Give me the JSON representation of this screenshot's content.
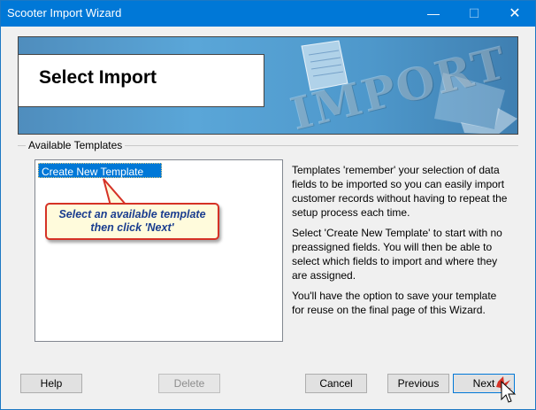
{
  "window": {
    "title": "Scooter Import Wizard",
    "min_glyph": "—",
    "max_glyph": "☐",
    "close_glyph": "✕"
  },
  "banner": {
    "heading": "Select Import",
    "art_word": "IMPORT"
  },
  "group": {
    "label": "Available Templates"
  },
  "templates": {
    "items": [
      "Create New Template"
    ],
    "selected": 0
  },
  "callout": {
    "line1": "Select an available template",
    "line2": "then click 'Next'"
  },
  "description": {
    "p1": "Templates 'remember' your selection of data fields to be imported so you can easily import customer records without having to repeat the setup process each time.",
    "p2": "Select 'Create New Template' to start with no preassigned fields. You will then be able to select which fields to import and where they are assigned.",
    "p3": "You'll have the option to save your template for reuse on the final page of this Wizard."
  },
  "buttons": {
    "help": "Help",
    "delete": "Delete",
    "cancel": "Cancel",
    "previous": "Previous",
    "next": "Next"
  },
  "colors": {
    "titlebar": "#0078d7",
    "selection": "#0078d7",
    "callout_border": "#d53226",
    "callout_text": "#1a3d8f"
  }
}
